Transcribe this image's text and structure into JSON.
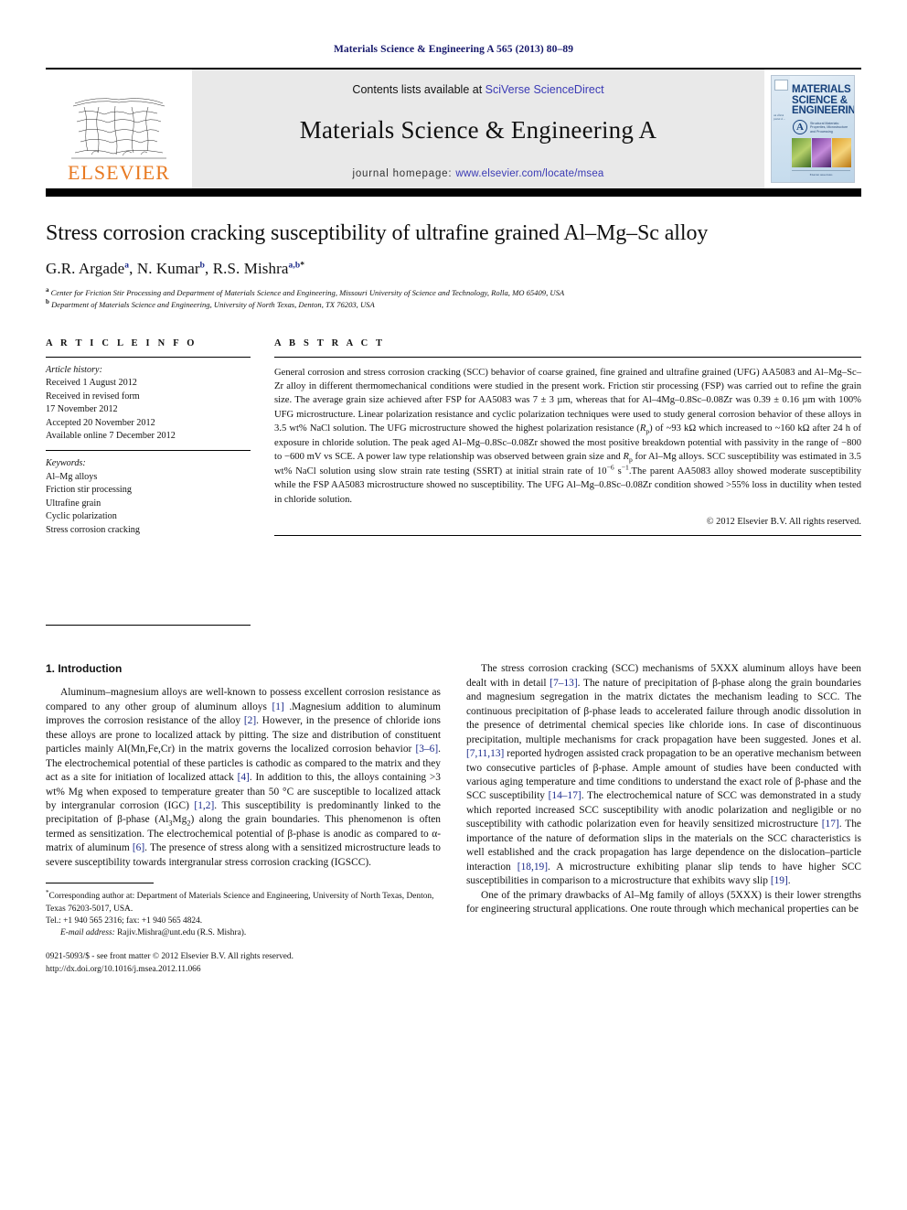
{
  "running_head": "Materials Science & Engineering A 565 (2013) 80–89",
  "masthead": {
    "publisher_logo_text": "ELSEVIER",
    "contents_prefix": "Contents lists available at ",
    "contents_link": "SciVerse ScienceDirect",
    "journal_title": "Materials Science & Engineering A",
    "homepage_prefix": "journal homepage: ",
    "homepage_url": "www.elsevier.com/locate/msea",
    "cover": {
      "line1": "MATERIALS",
      "line2": "SCIENCE &",
      "line3": "ENGINEERING",
      "badge": "A",
      "subtitle": "Structural Materials: Properties, Microstructure and Processing",
      "sidebar_text": "An official journal of ...",
      "footer": "Elsevier Associates"
    }
  },
  "article": {
    "title": "Stress corrosion cracking susceptibility of ultrafine grained Al–Mg–Sc alloy",
    "authors_html": "G.R. Argade a, N. Kumar b, R.S. Mishra a,b*",
    "authors": [
      {
        "name": "G.R. Argade",
        "marks": "a"
      },
      {
        "name": "N. Kumar",
        "marks": "b"
      },
      {
        "name": "R.S. Mishra",
        "marks": "a,b",
        "corresponding": "*"
      }
    ],
    "affiliations": [
      {
        "mark": "a",
        "text": "Center for Friction Stir Processing and Department of Materials Science and Engineering, Missouri University of Science and Technology, Rolla, MO 65409, USA"
      },
      {
        "mark": "b",
        "text": "Department of Materials Science and Engineering, University of North Texas, Denton, TX 76203, USA"
      }
    ]
  },
  "article_info": {
    "heading": "A R T I C L E   I N F O",
    "history_label": "Article history:",
    "history": [
      "Received 1 August 2012",
      "Received in revised form",
      "17 November 2012",
      "Accepted 20 November 2012",
      "Available online 7 December 2012"
    ],
    "keywords_label": "Keywords:",
    "keywords": [
      "Al–Mg alloys",
      "Friction stir processing",
      "Ultrafine grain",
      "Cyclic polarization",
      "Stress corrosion cracking"
    ]
  },
  "abstract": {
    "heading": "A B S T R A C T",
    "text": "General corrosion and stress corrosion cracking (SCC) behavior of coarse grained, fine grained and ultrafine grained (UFG) AA5083 and Al–Mg–Sc–Zr alloy in different thermomechanical conditions were studied in the present work. Friction stir processing (FSP) was carried out to refine the grain size. The average grain size achieved after FSP for AA5083 was 7 ± 3 µm, whereas that for Al–4Mg–0.8Sc–0.08Zr was 0.39 ± 0.16 µm with 100% UFG microstructure. Linear polarization resistance and cyclic polarization techniques were used to study general corrosion behavior of these alloys in 3.5 wt% NaCl solution. The UFG microstructure showed the highest polarization resistance (Rp) of ~93 kΩ which increased to ~160 kΩ after 24 h of exposure in chloride solution. The peak aged Al–Mg–0.8Sc–0.08Zr showed the most positive breakdown potential with passivity in the range of −800 to −600 mV vs SCE. A power law type relationship was observed between grain size and Rp for Al–Mg alloys. SCC susceptibility was estimated in 3.5 wt% NaCl solution using slow strain rate testing (SSRT) at initial strain rate of 10−6 s−1.The parent AA5083 alloy showed moderate susceptibility while the FSP AA5083 microstructure showed no susceptibility. The UFG Al–Mg–0.8Sc–0.08Zr condition showed >55% loss in ductility when tested in chloride solution.",
    "copyright": "© 2012 Elsevier B.V. All rights reserved."
  },
  "sections": {
    "intro_heading": "1.  Introduction",
    "left_paragraphs": [
      "Aluminum–magnesium alloys are well-known to possess excellent corrosion resistance as compared to any other group of aluminum alloys [1] .Magnesium addition to aluminum improves the corrosion resistance of the alloy [2]. However, in the presence of chloride ions these alloys are prone to localized attack by pitting. The size and distribution of constituent particles mainly Al(Mn,Fe,Cr) in the matrix governs the localized corrosion behavior [3–6]. The electrochemical potential of these particles is cathodic as compared to the matrix and they act as a site for initiation of localized attack [4]. In addition to this, the alloys containing >3 wt% Mg when exposed to temperature greater than 50 °C are susceptible to localized attack by intergranular corrosion (IGC) [1,2]. This susceptibility is predominantly linked to the precipitation of β-phase (Al3Mg2) along the grain boundaries. This phenomenon is often termed as sensitization. The electrochemical potential of β-phase is anodic as compared to α-matrix of aluminum [6]. The presence of stress along with a sensitized microstructure leads to severe susceptibility towards intergranular stress corrosion cracking (IGSCC)."
    ],
    "right_paragraphs": [
      "The stress corrosion cracking (SCC) mechanisms of 5XXX aluminum alloys have been dealt with in detail [7–13]. The nature of precipitation of β-phase along the grain boundaries and magnesium segregation in the matrix dictates the mechanism leading to SCC. The continuous precipitation of β-phase leads to accelerated failure through anodic dissolution in the presence of detrimental chemical species like chloride ions. In case of discontinuous precipitation, multiple mechanisms for crack propagation have been suggested. Jones et al. [7,11,13] reported hydrogen assisted crack propagation to be an operative mechanism between two consecutive particles of β-phase. Ample amount of studies have been conducted with various aging temperature and time conditions to understand the exact role of β-phase and the SCC susceptibility [14–17]. The electrochemical nature of SCC was demonstrated in a study which reported increased SCC susceptibility with anodic polarization and negligible or no susceptibility with cathodic polarization even for heavily sensitized microstructure [17]. The importance of the nature of deformation slips in the materials on the SCC characteristics is well established and the crack propagation has large dependence on the dislocation–particle interaction [18,19]. A microstructure exhibiting planar slip tends to have higher SCC susceptibilities in comparison to a microstructure that exhibits wavy slip [19].",
      "One of the primary drawbacks of Al–Mg family of alloys (5XXX) is their lower strengths for engineering structural applications. One route through which mechanical properties can be"
    ]
  },
  "footnote": {
    "marker": "*",
    "line1": "Corresponding author at: Department of Materials Science and Engineering, University of North Texas, Denton, Texas 76203-5017, USA.",
    "line2": "Tel.: +1 940 565 2316; fax: +1 940 565 4824.",
    "email_label": "E-mail address:",
    "email": "Rajiv.Mishra@unt.edu (R.S. Mishra)."
  },
  "imprint": {
    "line1": "0921-5093/$ - see front matter © 2012 Elsevier B.V. All rights reserved.",
    "line2": "http://dx.doi.org/10.1016/j.msea.2012.11.066"
  }
}
